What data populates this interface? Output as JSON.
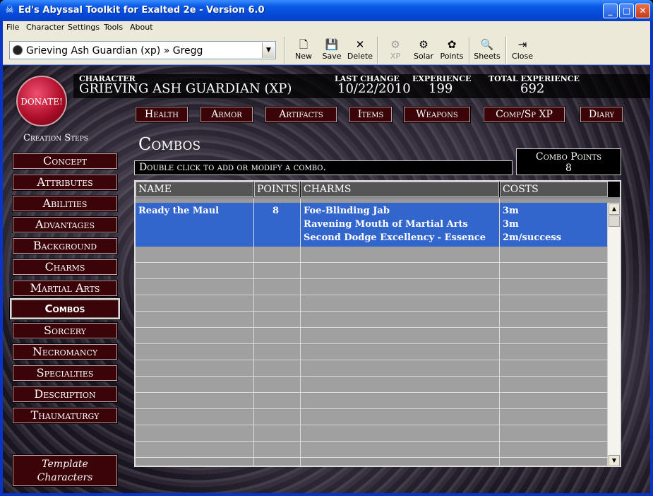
{
  "window": {
    "title": "Ed's Abyssal Toolkit for Exalted 2e - Version 6.0",
    "controls": {
      "minimize": "_",
      "maximize": "□",
      "close": "✕"
    }
  },
  "menu": [
    "File",
    "Character",
    "Settings",
    "Tools",
    "About"
  ],
  "toolbar": {
    "character_selector": "Grieving Ash Guardian (xp) » Gregg",
    "buttons": [
      {
        "label": "New",
        "icon": "🗋"
      },
      {
        "label": "Save",
        "icon": "💾"
      },
      {
        "label": "Delete",
        "icon": "✕"
      },
      {
        "label": "XP",
        "icon": "⚙",
        "disabled": true
      },
      {
        "label": "Solar",
        "icon": "⚙"
      },
      {
        "label": "Points",
        "icon": "✿"
      },
      {
        "label": "Sheets",
        "icon": "🔍"
      },
      {
        "label": "Close",
        "icon": "⇥"
      }
    ]
  },
  "header": {
    "character_label": "CHARACTER",
    "character_name": "GRIEVING ASH GUARDIAN (XP)",
    "last_change_label": "LAST CHANGE",
    "last_change": "10/22/2010",
    "experience_label": "EXPERIENCE",
    "experience": "199",
    "total_experience_label": "TOTAL EXPERIENCE",
    "total_experience": "692",
    "donate": "DONATE!"
  },
  "top_buttons": [
    "Health",
    "Armor",
    "Artifacts",
    "Items",
    "Weapons",
    "Comp/Sp XP",
    "Diary"
  ],
  "creation_steps_label": "Creation Steps",
  "creation_steps": [
    "Concept",
    "Attributes",
    "Abilities",
    "Advantages",
    "Background",
    "Charms",
    "Martial Arts",
    "Combos",
    "Sorcery",
    "Necromancy",
    "Specialties",
    "Description",
    "Thaumaturgy"
  ],
  "active_step": "Combos",
  "template_button": [
    "Template",
    "Characters"
  ],
  "combos": {
    "title": "Combos",
    "hint": "Double click to add or modify a combo.",
    "points_label": "Combo Points",
    "points_value": "8",
    "columns": [
      "NAME",
      "POINTS",
      "CHARMS",
      "COSTS"
    ],
    "rows": [
      {
        "name": "Ready the Maul",
        "points": "8",
        "charms": [
          "Foe-Blinding Jab",
          "Ravening Mouth of Martial Arts",
          "Second Dodge Excellency - Essence"
        ],
        "costs": [
          "3m",
          "3m",
          "2m/success"
        ]
      }
    ]
  }
}
